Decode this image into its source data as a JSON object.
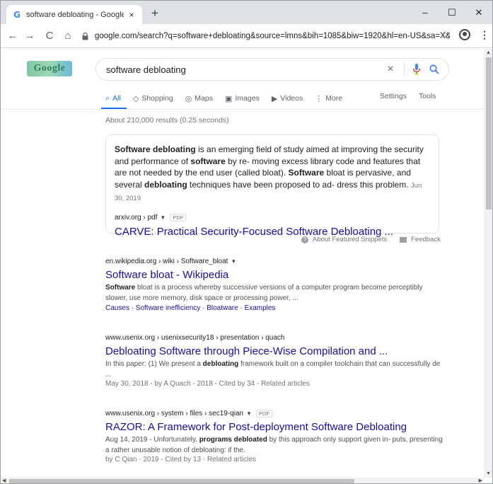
{
  "browser": {
    "tab": {
      "title": "software debloating - Google Se",
      "favicon": "G",
      "close": "×"
    },
    "new_tab": "+",
    "controls": {
      "minimize": "–",
      "maximize": "☐",
      "close": "✕"
    },
    "nav": {
      "back": "←",
      "forward": "→",
      "reload": "C",
      "home": "⌂"
    },
    "url": "google.com/search?q=software+debloating&source=lmns&bih=1085&biw=1920&hl=en-US&sa=X&v...",
    "bookmark_icon": "☆",
    "menu_icon": "⋮"
  },
  "search": {
    "logo_text": "Google",
    "query": "software debloating",
    "clear": "×"
  },
  "tabs": [
    {
      "icon": "⌕",
      "label": "All"
    },
    {
      "icon": "◇",
      "label": "Shopping"
    },
    {
      "icon": "◎",
      "label": "Maps"
    },
    {
      "icon": "▣",
      "label": "Images"
    },
    {
      "icon": "▶",
      "label": "Videos"
    },
    {
      "icon": "⋮",
      "label": "More"
    }
  ],
  "tabs_right": {
    "settings": "Settings",
    "tools": "Tools"
  },
  "result_stats": "About 210,000 results (0.25 seconds)",
  "featured": {
    "p1_b": "Software debloating",
    "p1": " is an emerging field of study aimed at improving the security and performance of ",
    "p2_b": "software",
    "p2": " by re- moving excess library code and features that are not needed by the end user (called bloat). ",
    "p3_b": "Software",
    "p3": " bloat is pervasive, and several ",
    "p4_b": "debloating",
    "p4": " techniques have been proposed to ad- dress this problem.",
    "date": "Jun 30, 2019",
    "source": "arxiv.org › pdf",
    "pdf": "PDF",
    "title": "CARVE: Practical Security-Focused Software Debloating ...",
    "about": "About Featured Snippets",
    "feedback": "Feedback"
  },
  "results": [
    {
      "cite": "en.wikipedia.org › wiki › Software_bloat",
      "title": "Software bloat - Wikipedia",
      "desc_b": "Software",
      "desc": " bloat is a process whereby successive versions of a computer program become perceptibly slower, use more memory, disk space or processing power, ...",
      "links": "Causes · Software inefficiency · Bloatware · Examples"
    },
    {
      "cite": "www.usenix.org › usenixsecurity18 › presentation › quach",
      "title": "Debloating Software through Piece-Wise Compilation and ...",
      "desc_a": "In this paper: (1) We present a ",
      "desc_b": "debloating",
      "desc": " framework built on a compiler toolchain that can successfully de ...",
      "meta": "May 30, 2018 - by A Quach - 2018 - Cited by 34 - Related articles"
    },
    {
      "cite": "www.usenix.org › system › files › sec19-qian",
      "pdf": "PDF",
      "title": "RAZOR: A Framework for Post-deployment Software Debloating",
      "desc_a": "Aug 14, 2019 - Unfortunately, ",
      "desc_b": "programs debloated",
      "desc": " by this approach only support given in- puts, presenting a rather unusable notion of debloating: if the.",
      "meta": "by C Qian - 2019 - Cited by 13 - Related articles"
    }
  ]
}
